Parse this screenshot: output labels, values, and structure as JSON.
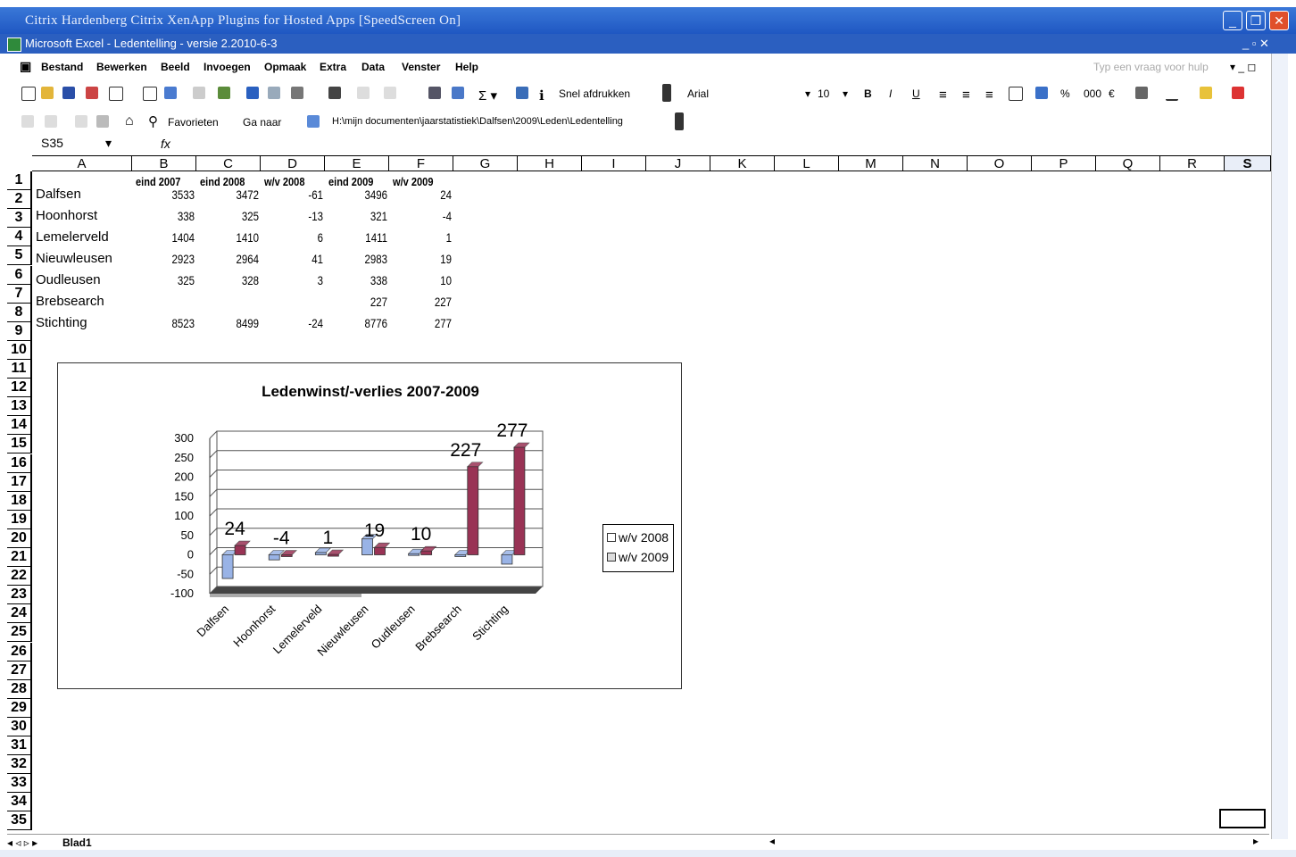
{
  "citrix": {
    "title": "Citrix Hardenberg   Citrix XenApp Plugins for Hosted Apps [SpeedScreen On]"
  },
  "excel": {
    "title": "Microsoft Excel - Ledentelling - versie 2.2010-6-3"
  },
  "menu": [
    "Bestand",
    "Bewerken",
    "Beeld",
    "Invoegen",
    "Opmaak",
    "Extra",
    "Data",
    "Venster",
    "Help"
  ],
  "ask_box": "Typ een vraag voor hulp",
  "toolbar": {
    "quick_print": "Snel afdrukken",
    "font_name": "Arial",
    "font_size": "10",
    "bold": "B",
    "italic": "I",
    "underline": "U",
    "percent": "%",
    "thousands": "000",
    "euro": "€"
  },
  "web_toolbar": {
    "favorites": "Favorieten",
    "go": "Ga naar",
    "path": "H:\\mijn documenten\\jaarstatistiek\\Dalfsen\\2009\\Leden\\Ledentelling"
  },
  "formula_bar": {
    "name_box": "S35",
    "fx": "fx"
  },
  "columns": [
    "A",
    "B",
    "C",
    "D",
    "E",
    "F",
    "G",
    "H",
    "I",
    "J",
    "K",
    "L",
    "M",
    "N",
    "O",
    "P",
    "Q",
    "R",
    "S"
  ],
  "rows": [
    "1",
    "2",
    "3",
    "4",
    "5",
    "6",
    "7",
    "8",
    "9",
    "10",
    "11",
    "12",
    "13",
    "14",
    "15",
    "16",
    "17",
    "18",
    "19",
    "20",
    "21",
    "22",
    "23",
    "24",
    "25",
    "26",
    "27",
    "28",
    "29",
    "30",
    "31",
    "32",
    "33",
    "34",
    "35"
  ],
  "table": {
    "headers": [
      "eind 2007",
      "eind 2008",
      "w/v 2008",
      "eind 2009",
      "w/v 2009"
    ],
    "rows": [
      {
        "name": "Dalfsen",
        "v": [
          "3533",
          "3472",
          "-61",
          "3496",
          "24"
        ]
      },
      {
        "name": "Hoonhorst",
        "v": [
          "338",
          "325",
          "-13",
          "321",
          "-4"
        ]
      },
      {
        "name": "Lemelerveld",
        "v": [
          "1404",
          "1410",
          "6",
          "1411",
          "1"
        ]
      },
      {
        "name": "Nieuwleusen",
        "v": [
          "2923",
          "2964",
          "41",
          "2983",
          "19"
        ]
      },
      {
        "name": "Oudleusen",
        "v": [
          "325",
          "328",
          "3",
          "338",
          "10"
        ]
      },
      {
        "name": "Brebsearch",
        "v": [
          "",
          "",
          "",
          "227",
          "227"
        ]
      },
      {
        "name": "Stichting",
        "v": [
          "8523",
          "8499",
          "-24",
          "8776",
          "277"
        ]
      }
    ]
  },
  "chart_data": {
    "type": "bar",
    "title": "Ledenwinst/-verlies 2007-2009",
    "categories": [
      "Dalfsen",
      "Hoonhorst",
      "Lemelerveld",
      "Nieuwleusen",
      "Oudleusen",
      "Brebsearch",
      "Stichting"
    ],
    "series": [
      {
        "name": "w/v 2008",
        "values": [
          -61,
          -13,
          6,
          41,
          3,
          0,
          -24
        ],
        "color": "#99b3e6"
      },
      {
        "name": "w/v 2009",
        "values": [
          24,
          -4,
          1,
          19,
          10,
          227,
          277
        ],
        "color": "#993355"
      }
    ],
    "data_labels": [
      "24",
      "-4",
      "1",
      "19",
      "10",
      "227",
      "277"
    ],
    "y_ticks": [
      "300",
      "250",
      "200",
      "150",
      "100",
      "50",
      "0",
      "-50",
      "-100"
    ],
    "ylim": [
      -100,
      300
    ],
    "grid": true,
    "legend": "right"
  },
  "sheet_tab": "Blad1"
}
